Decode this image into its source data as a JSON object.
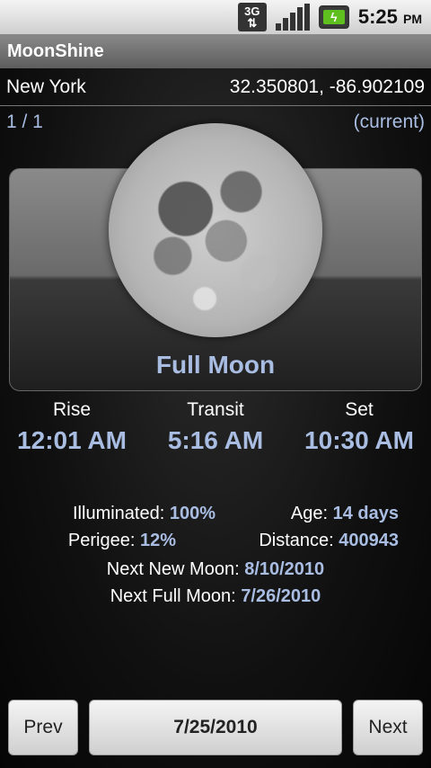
{
  "status": {
    "network": "3G",
    "time": "5:25",
    "ampm": "PM"
  },
  "app": {
    "title": "MoonShine"
  },
  "location": {
    "name": "New York",
    "coords": "32.350801, -86.902109"
  },
  "pager": {
    "position": "1 / 1",
    "state": "(current)"
  },
  "phase": {
    "name": "Full Moon"
  },
  "times": {
    "rise_label": "Rise",
    "rise": "12:01 AM",
    "transit_label": "Transit",
    "transit": "5:16 AM",
    "set_label": "Set",
    "set": "10:30 AM"
  },
  "stats": {
    "illuminated_label": "Illuminated:",
    "illuminated": "100%",
    "age_label": "Age:",
    "age": "14 days",
    "perigee_label": "Perigee:",
    "perigee": "12%",
    "distance_label": "Distance:",
    "distance": "400943",
    "next_new_label": "Next New Moon:",
    "next_new": "8/10/2010",
    "next_full_label": "Next Full Moon:",
    "next_full": "7/26/2010"
  },
  "nav": {
    "prev": "Prev",
    "date": "7/25/2010",
    "next": "Next"
  }
}
